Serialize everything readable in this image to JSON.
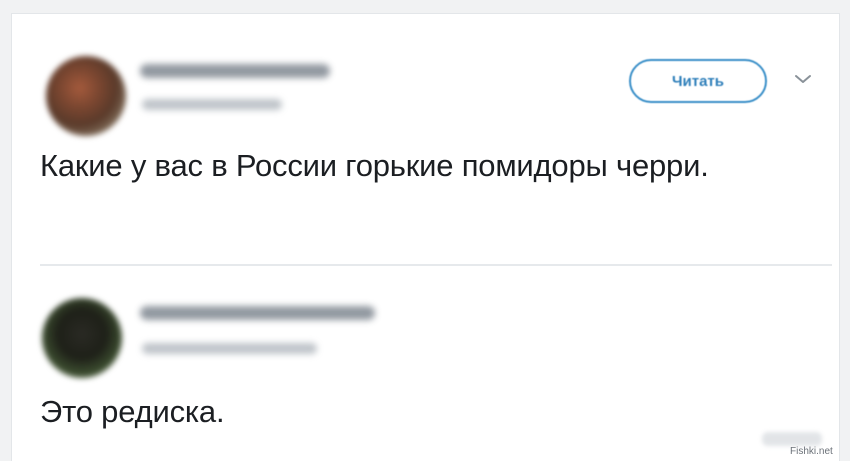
{
  "tweets": [
    {
      "follow_label": "Читать",
      "text": "Какие у вас в России горькие помидоры черри."
    },
    {
      "text": "Это редиска."
    }
  ],
  "icons": {
    "more": "chevron-down-icon"
  },
  "colors": {
    "accent": "#3a8fc8",
    "text": "#1b1e22",
    "divider": "#e6e9ec"
  },
  "watermark": "Fishki.net"
}
